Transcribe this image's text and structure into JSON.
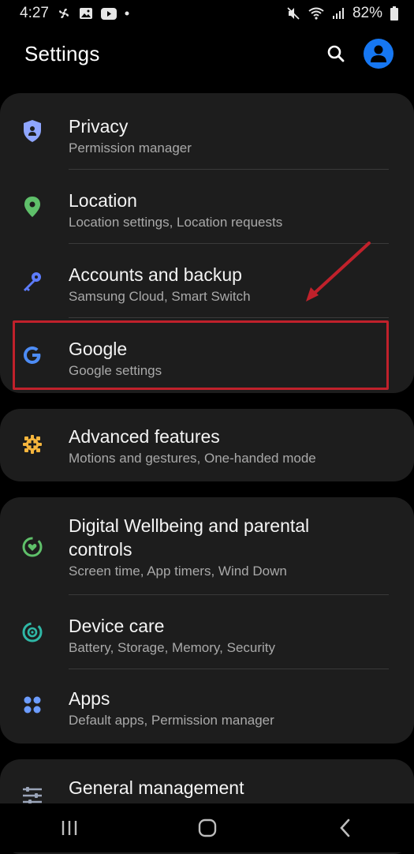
{
  "status_bar": {
    "time": "4:27",
    "battery": "82%"
  },
  "header": {
    "title": "Settings"
  },
  "sections": {
    "group1": [
      {
        "title": "Privacy",
        "subtitle": "Permission manager",
        "icon": "shield-icon"
      },
      {
        "title": "Location",
        "subtitle": "Location settings, Location requests",
        "icon": "location-pin-icon"
      },
      {
        "title": "Accounts and backup",
        "subtitle": "Samsung Cloud, Smart Switch",
        "icon": "key-icon"
      },
      {
        "title": "Google",
        "subtitle": "Google settings",
        "icon": "google-icon"
      }
    ],
    "group2": [
      {
        "title": "Advanced features",
        "subtitle": "Motions and gestures, One-handed mode",
        "icon": "gear-plus-icon"
      }
    ],
    "group3": [
      {
        "title": "Digital Wellbeing and parental controls",
        "title_line1": "Digital Wellbeing and parental",
        "title_line2": "controls",
        "subtitle": "Screen time, App timers, Wind Down",
        "icon": "wellbeing-icon"
      },
      {
        "title": "Device care",
        "subtitle": "Battery, Storage, Memory, Security",
        "icon": "device-care-icon"
      },
      {
        "title": "Apps",
        "subtitle": "Default apps, Permission manager",
        "icon": "apps-grid-icon"
      }
    ],
    "group4": [
      {
        "title": "General management",
        "icon": "sliders-icon"
      }
    ]
  },
  "colors": {
    "background": "#000000",
    "card": "#1d1d1d",
    "accent_blue": "#1677f2",
    "highlight_red": "#c0212b"
  }
}
